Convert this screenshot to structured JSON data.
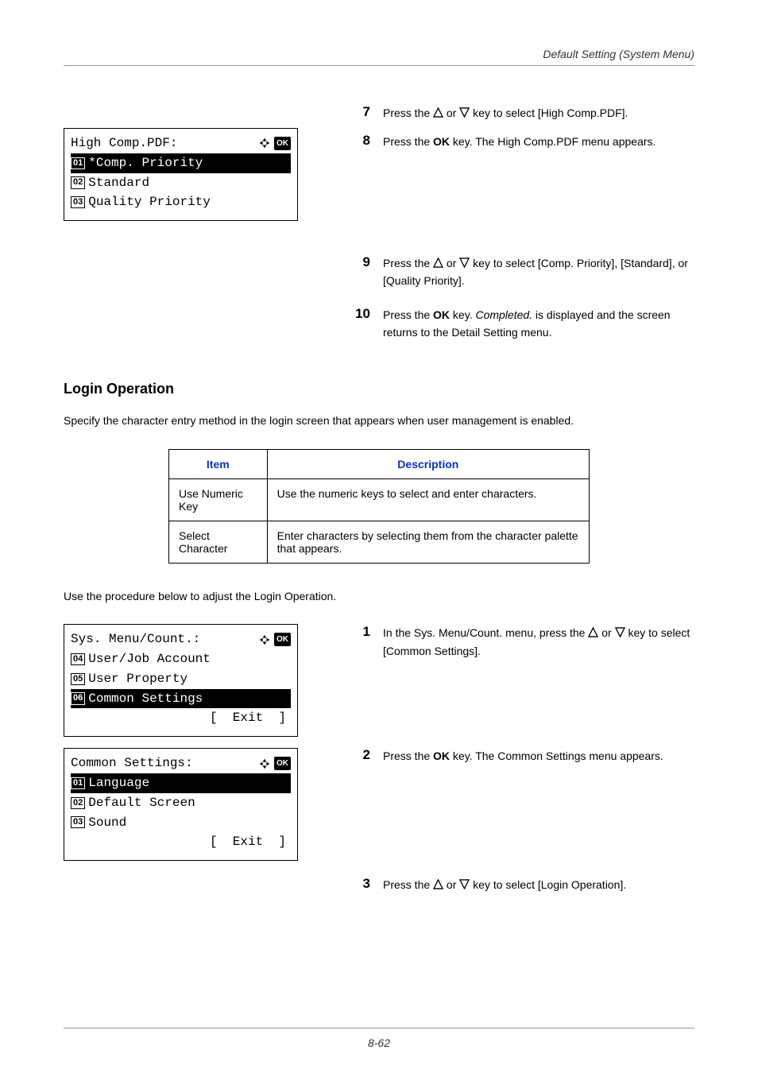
{
  "header": {
    "title": "Default Setting (System Menu)"
  },
  "ok_label": "OK",
  "lcd1": {
    "title": "High Comp.PDF:",
    "items": [
      {
        "num": "01",
        "text": "*Comp. Priority",
        "selected": true
      },
      {
        "num": "02",
        "text": "Standard",
        "selected": false
      },
      {
        "num": "03",
        "text": "Quality Priority",
        "selected": false
      }
    ]
  },
  "steps_top": [
    {
      "n": "7",
      "pre": "Press the ",
      "post": " key to select [High Comp.PDF]."
    },
    {
      "n": "8",
      "html": "Press the <span class=\"bold\">OK</span> key. The High Comp.PDF menu appears."
    },
    {
      "n": "9",
      "pre": "Press the ",
      "post": " key to select [Comp. Priority], [Standard], or [Quality Priority]."
    },
    {
      "n": "10",
      "html": "Press the <span class=\"bold\">OK</span> key. <span class=\"italic\">Completed.</span> is displayed and the screen returns to the Detail Setting menu."
    }
  ],
  "login_section": {
    "heading": "Login Operation",
    "intro": "Specify the character entry method in the login screen that appears when user management is enabled.",
    "table": {
      "headers": [
        "Item",
        "Description"
      ],
      "rows": [
        [
          "Use Numeric Key",
          "Use the numeric keys to select and enter characters."
        ],
        [
          "Select Character",
          "Enter characters by selecting them from the character palette that appears."
        ]
      ]
    },
    "procedure_lead": "Use the procedure below to adjust the Login Operation."
  },
  "lcd2": {
    "title": "Sys. Menu/Count.:",
    "items": [
      {
        "num": "04",
        "text": "User/Job Account",
        "selected": false
      },
      {
        "num": "05",
        "text": "User Property",
        "selected": false
      },
      {
        "num": "06",
        "text": "Common Settings",
        "selected": true
      }
    ],
    "softkey": "[  Exit  ]"
  },
  "lcd3": {
    "title": "Common Settings:",
    "items": [
      {
        "num": "01",
        "text": "Language",
        "selected": true
      },
      {
        "num": "02",
        "text": "Default Screen",
        "selected": false
      },
      {
        "num": "03",
        "text": "Sound",
        "selected": false
      }
    ],
    "softkey": "[  Exit  ]"
  },
  "steps_bottom": [
    {
      "n": "1",
      "pre": "In the Sys. Menu/Count. menu, press the ",
      "post": " key to select [Common Settings]."
    },
    {
      "n": "2",
      "html": "Press the <span class=\"bold\">OK</span> key. The Common Settings menu appears."
    },
    {
      "n": "3",
      "pre": "Press the ",
      "post": " key to select [Login Operation]."
    }
  ],
  "page_number": "8-62"
}
